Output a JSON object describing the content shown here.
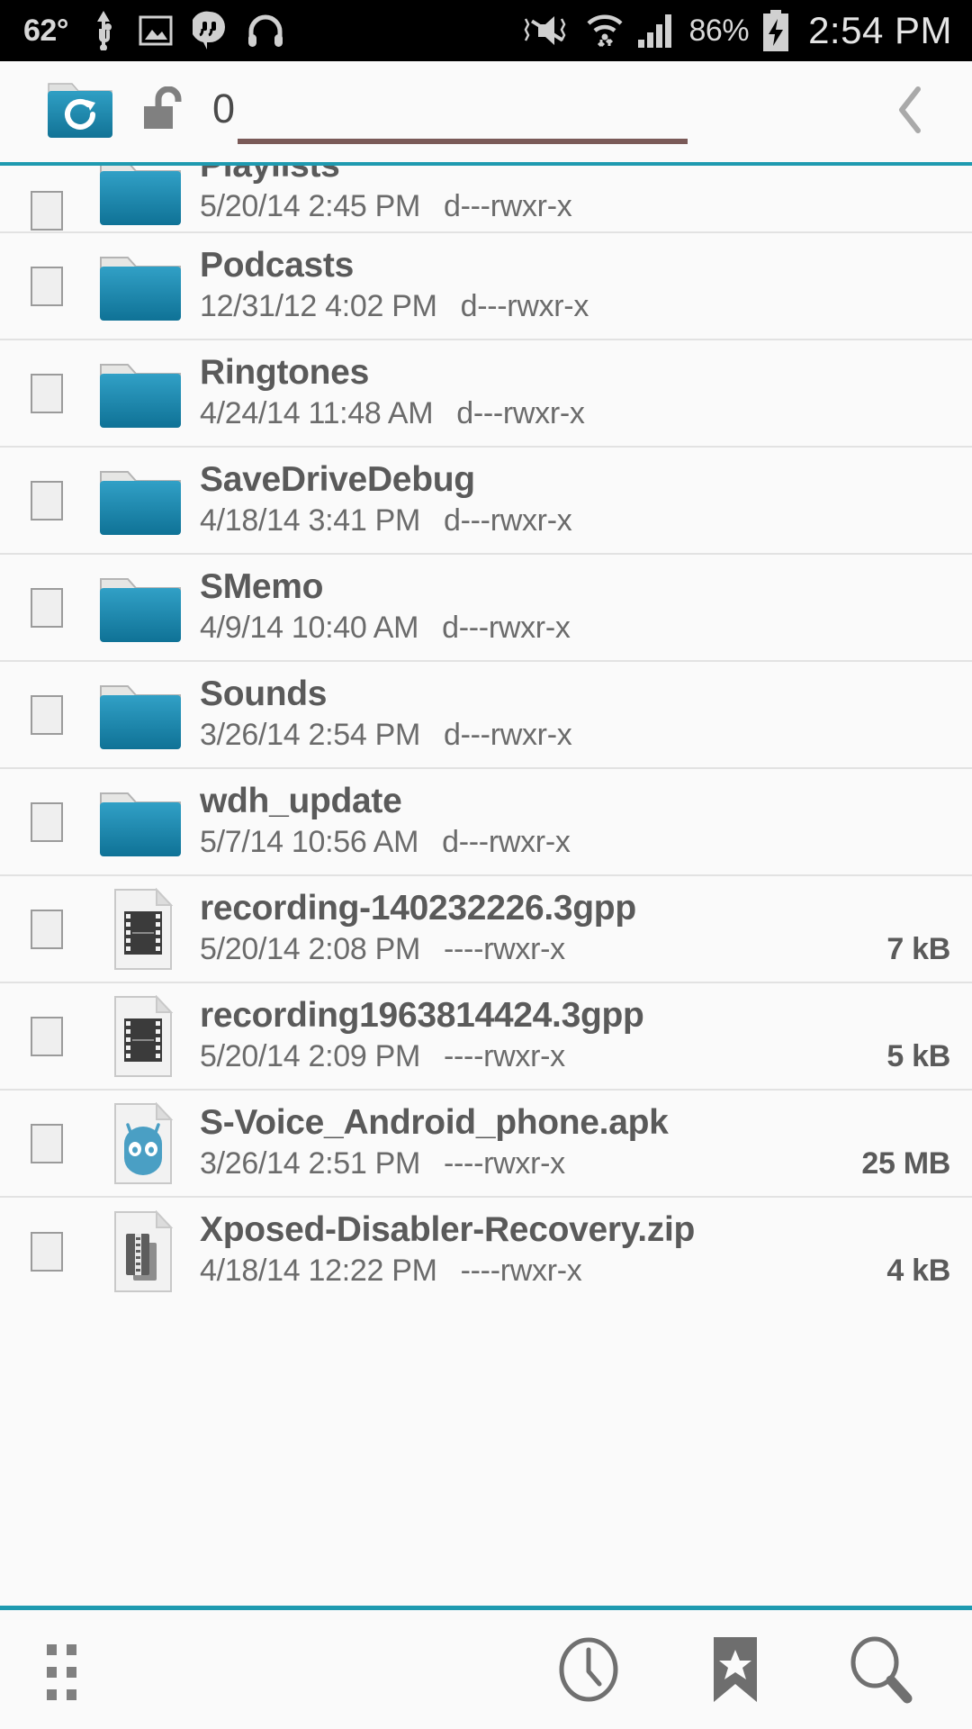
{
  "statusbar": {
    "temperature": "62°",
    "left_icons": [
      "usb-icon",
      "screenshot-image-icon",
      "hangouts-icon",
      "headphones-icon"
    ],
    "right_icons": [
      "mute-vibrate-off-icon",
      "wifi-icon",
      "cellular-signal-icon"
    ],
    "battery_percent": "86%",
    "battery_icon": "battery-charging-icon",
    "time": "2:54 PM"
  },
  "toolbar": {
    "folder_icon": "folder-refresh-icon",
    "lock_icon": "unlock-icon",
    "path_value": "0",
    "path_placeholder": "0",
    "back_icon": "chevron-left-icon"
  },
  "colors": {
    "accent_teal": "#1e9ab0",
    "folder_blue": "#1e87b0",
    "underline": "#7a5a58",
    "text_primary": "#5a5a5a",
    "text_secondary": "#6b6b6b"
  },
  "list": {
    "columns": [
      "name",
      "date",
      "permissions",
      "size"
    ],
    "rows": [
      {
        "name": "Playlists",
        "date": "5/20/14 2:45 PM",
        "permissions": "d---rwxr-x",
        "size": "",
        "icon": "folder-icon",
        "clipped": true
      },
      {
        "name": "Podcasts",
        "date": "12/31/12 4:02 PM",
        "permissions": "d---rwxr-x",
        "size": "",
        "icon": "folder-icon",
        "clipped": false
      },
      {
        "name": "Ringtones",
        "date": "4/24/14 11:48 AM",
        "permissions": "d---rwxr-x",
        "size": "",
        "icon": "folder-icon",
        "clipped": false
      },
      {
        "name": "SaveDriveDebug",
        "date": "4/18/14 3:41 PM",
        "permissions": "d---rwxr-x",
        "size": "",
        "icon": "folder-icon",
        "clipped": false
      },
      {
        "name": "SMemo",
        "date": "4/9/14 10:40 AM",
        "permissions": "d---rwxr-x",
        "size": "",
        "icon": "folder-icon",
        "clipped": false
      },
      {
        "name": "Sounds",
        "date": "3/26/14 2:54 PM",
        "permissions": "d---rwxr-x",
        "size": "",
        "icon": "folder-icon",
        "clipped": false
      },
      {
        "name": "wdh_update",
        "date": "5/7/14 10:56 AM",
        "permissions": "d---rwxr-x",
        "size": "",
        "icon": "folder-icon",
        "clipped": false
      },
      {
        "name": "recording-140232226.3gpp",
        "date": "5/20/14 2:08 PM",
        "permissions": "----rwxr-x",
        "size": "7 kB",
        "icon": "video-file-icon",
        "clipped": false
      },
      {
        "name": "recording1963814424.3gpp",
        "date": "5/20/14 2:09 PM",
        "permissions": "----rwxr-x",
        "size": "5 kB",
        "icon": "video-file-icon",
        "clipped": false
      },
      {
        "name": "S-Voice_Android_phone.apk",
        "date": "3/26/14 2:51 PM",
        "permissions": "----rwxr-x",
        "size": "25 MB",
        "icon": "apk-file-icon",
        "clipped": false
      },
      {
        "name": "Xposed-Disabler-Recovery.zip",
        "date": "4/18/14 12:22 PM",
        "permissions": "----rwxr-x",
        "size": "4 kB",
        "icon": "zip-file-icon",
        "clipped": false
      }
    ]
  },
  "bottombar": {
    "items": [
      {
        "icon": "grid-menu-icon",
        "label": "Menu"
      },
      {
        "icon": "clock-icon",
        "label": "Recent"
      },
      {
        "icon": "bookmark-icon",
        "label": "Bookmarks"
      },
      {
        "icon": "search-icon",
        "label": "Search"
      }
    ]
  }
}
